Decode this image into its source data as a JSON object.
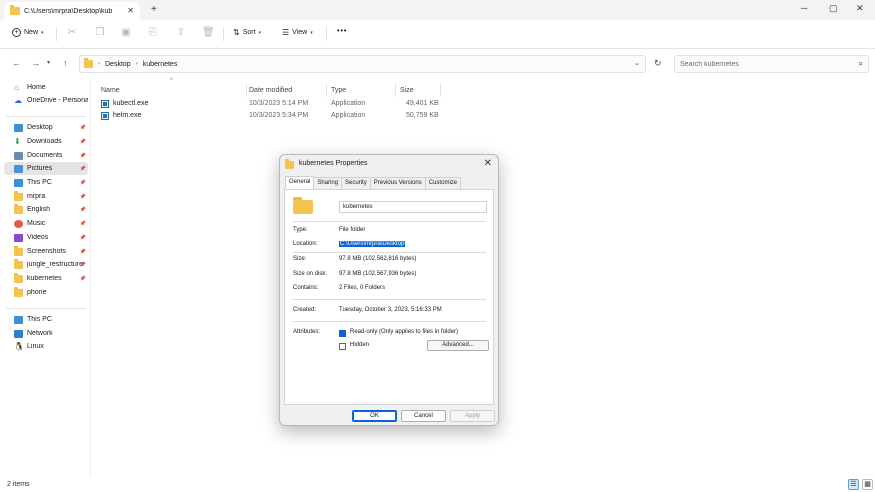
{
  "window": {
    "tab_title": "C:\\Users\\mrpra\\Desktop\\kub",
    "tab_close": "✕",
    "new_tab": "+",
    "minimize": "─",
    "maximize": "▢",
    "close": "✕"
  },
  "toolbar": {
    "new_label": "New",
    "sort_label": "Sort",
    "view_label": "View",
    "more": "•••"
  },
  "address": {
    "crumbs": [
      "Desktop",
      "kubernetes"
    ],
    "search_placeholder": "Search kubernetes"
  },
  "sidebar": {
    "top_items": [
      {
        "label": "Home",
        "icon": "home-icon"
      },
      {
        "label": "OneDrive - Personal",
        "icon": "cloud-icon"
      }
    ],
    "pinned_items": [
      {
        "label": "Desktop",
        "icon": "desktop-icon"
      },
      {
        "label": "Downloads",
        "icon": "download-icon"
      },
      {
        "label": "Documents",
        "icon": "document-icon"
      },
      {
        "label": "Pictures",
        "icon": "picture-icon"
      },
      {
        "label": "This PC",
        "icon": "computer-icon"
      },
      {
        "label": "mrpra",
        "icon": "folder-icon"
      },
      {
        "label": "English",
        "icon": "folder-icon"
      },
      {
        "label": "Music",
        "icon": "music-icon"
      },
      {
        "label": "Videos",
        "icon": "video-icon"
      },
      {
        "label": "Screenshots",
        "icon": "folder-icon"
      },
      {
        "label": "jungle_restructure",
        "icon": "folder-icon"
      },
      {
        "label": "kubernetes",
        "icon": "folder-icon"
      },
      {
        "label": "phone",
        "icon": "folder-icon"
      }
    ],
    "bottom_items": [
      {
        "label": "This PC",
        "icon": "computer-icon"
      },
      {
        "label": "Network",
        "icon": "network-icon"
      },
      {
        "label": "Linux",
        "icon": "linux-icon"
      }
    ]
  },
  "filelist": {
    "columns": [
      "Name",
      "Date modified",
      "Type",
      "Size"
    ],
    "rows": [
      {
        "name": "kubectl.exe",
        "date": "10/3/2023 5:14 PM",
        "type": "Application",
        "size": "49,401 KB"
      },
      {
        "name": "helm.exe",
        "date": "10/3/2023 5:34 PM",
        "type": "Application",
        "size": "50,759 KB"
      }
    ]
  },
  "status": {
    "items_count": "2 items"
  },
  "dialog": {
    "title": "kubernetes Properties",
    "tabs": [
      "General",
      "Sharing",
      "Security",
      "Previous Versions",
      "Customize"
    ],
    "folder_name": "kubernetes",
    "labels": {
      "type": "Type:",
      "location": "Location:",
      "size": "Size:",
      "size_on_disk": "Size on disk:",
      "contains": "Contains:",
      "created": "Created:",
      "attributes": "Attributes:"
    },
    "values": {
      "type": "File folder",
      "location": "C:\\Users\\mrpra\\Desktop",
      "size": "97.8 MB (102,562,816 bytes)",
      "size_on_disk": "97.8 MB (102,567,936 bytes)",
      "contains": "2 Files, 0 Folders",
      "created": "Tuesday, October 3, 2023, 5:16:33 PM"
    },
    "attributes": {
      "readonly_label": "Read-only (Only applies to files in folder)",
      "readonly_checked": true,
      "hidden_label": "Hidden",
      "hidden_checked": false,
      "advanced_label": "Advanced..."
    },
    "buttons": {
      "ok": "OK",
      "cancel": "Cancel",
      "apply": "Apply"
    }
  }
}
